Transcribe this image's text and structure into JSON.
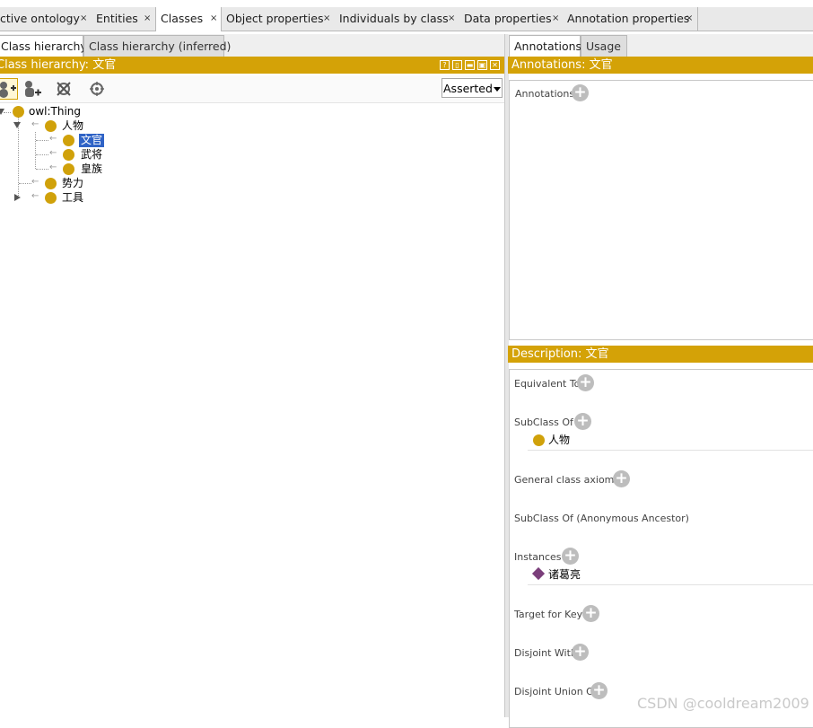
{
  "top_tabs": [
    {
      "label": "ctive ontology",
      "close": "×"
    },
    {
      "label": "Entities",
      "close": "×"
    },
    {
      "label": "Classes",
      "close": "×",
      "selected": true
    },
    {
      "label": "Object properties",
      "close": "×"
    },
    {
      "label": "Individuals by class",
      "close": "×"
    },
    {
      "label": "Data properties",
      "close": "×"
    },
    {
      "label": "Annotation properties",
      "close": "×"
    }
  ],
  "left": {
    "subtabs": [
      "Class hierarchy",
      "Class hierarchy (inferred)"
    ],
    "header": "Class hierarchy: 文官",
    "header_buttons": [
      "?",
      "▯",
      "▬",
      "▣",
      "✕"
    ],
    "dropdown_value": "Asserted",
    "tree": {
      "root": "owl:Thing",
      "n1": "人物",
      "n1a": "文官",
      "n1b": "武将",
      "n1c": "皇族",
      "n2": "势力",
      "n3": "工具"
    }
  },
  "right": {
    "subtabs": [
      "Annotations",
      "Usage"
    ],
    "annotations_header": "Annotations: 文官",
    "annotations_label": "Annotations",
    "description_header": "Description: 文官",
    "sections": {
      "equivalent_to": "Equivalent To",
      "subclass_of": "SubClass Of",
      "subclass_value": "人物",
      "general_axioms": "General class axioms",
      "subclass_anon": "SubClass Of (Anonymous Ancestor)",
      "instances": "Instances",
      "instance_value": "诸葛亮",
      "target_for_key": "Target for Key",
      "disjoint_with": "Disjoint With",
      "disjoint_union": "Disjoint Union Of"
    }
  },
  "watermark": "CSDN @cooldream2009",
  "colors": {
    "accent": "#d4a207",
    "selection": "#2f63c6",
    "individual": "#7b3f7b",
    "class_dot": "#d0a10a"
  }
}
